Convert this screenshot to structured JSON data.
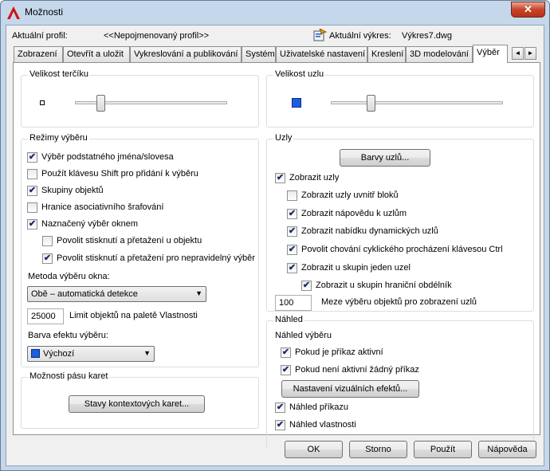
{
  "window": {
    "title": "Možnosti",
    "close_glyph": "✕"
  },
  "header": {
    "profile_label": "Aktuální profil:",
    "profile_value": "<<Nepojmenovaný profil>>",
    "drawing_label": "Aktuální výkres:",
    "drawing_value": "Výkres7.dwg"
  },
  "tabs": [
    {
      "label": "Zobrazení"
    },
    {
      "label": "Otevřít a uložit"
    },
    {
      "label": "Vykreslování a publikování"
    },
    {
      "label": "Systém"
    },
    {
      "label": "Uživatelské nastavení"
    },
    {
      "label": "Kreslení"
    },
    {
      "label": "3D modelování"
    },
    {
      "label": "Výběr"
    }
  ],
  "tab_scroll": {
    "left": "◄",
    "right": "►"
  },
  "pickbox": {
    "title": "Velikost terčíku",
    "level": 0.15
  },
  "grip_size": {
    "title": "Velikost uzlu",
    "level": 0.22
  },
  "selection_modes": {
    "title": "Režimy výběru",
    "items": [
      {
        "label": "Výběr podstatného jména/slovesa",
        "checked": true
      },
      {
        "label": "Použít klávesu Shift pro přidání k výběru",
        "checked": false
      },
      {
        "label": "Skupiny objektů",
        "checked": true
      },
      {
        "label": "Hranice asociativního šrafování",
        "checked": false
      },
      {
        "label": "Naznačený výběr oknem",
        "checked": true
      },
      {
        "label": "Povolit stisknutí a přetažení u objektu",
        "checked": false
      },
      {
        "label": "Povolit stisknutí a přetažení pro nepravidelný výběr",
        "checked": true
      }
    ],
    "window_method_label": "Metoda výběru okna:",
    "window_method_value": "Obě – automatická detekce",
    "object_limit_value": "25000",
    "object_limit_label": "Limit objektů na paletě Vlastnosti",
    "effect_color_label": "Barva efektu výběru:",
    "effect_color_value": "Výchozí",
    "effect_color_hex": "#1b5ee0"
  },
  "ribbon": {
    "title": "Možnosti pásu karet",
    "button_label": "Stavy kontextových karet..."
  },
  "grips": {
    "title": "Uzly",
    "colors_button": "Barvy uzlů...",
    "items": [
      {
        "label": "Zobrazit uzly",
        "checked": true
      },
      {
        "label": "Zobrazit uzly uvnitř bloků",
        "checked": false
      },
      {
        "label": "Zobrazit nápovědu k uzlům",
        "checked": true
      },
      {
        "label": "Zobrazit nabídku dynamických uzlů",
        "checked": true
      },
      {
        "label": "Povolit chování cyklického procházení klávesou Ctrl",
        "checked": true
      },
      {
        "label": "Zobrazit u skupin jeden uzel",
        "checked": true
      },
      {
        "label": "Zobrazit u skupin hraniční obdélník",
        "checked": true
      }
    ],
    "limit_value": "100",
    "limit_label": "Meze výběru objektů pro zobrazení uzlů"
  },
  "preview": {
    "title": "Náhled",
    "subtitle": "Náhled výběru",
    "items": [
      {
        "label": "Pokud je příkaz aktivní",
        "checked": true
      },
      {
        "label": "Pokud není aktivní žádný příkaz",
        "checked": true
      }
    ],
    "effects_button": "Nastavení vizuálních efektů...",
    "items2": [
      {
        "label": "Náhled příkazu",
        "checked": true
      },
      {
        "label": "Náhled vlastnosti",
        "checked": true
      }
    ]
  },
  "footer": {
    "ok": "OK",
    "cancel": "Storno",
    "apply": "Použít",
    "help": "Nápověda"
  },
  "icons": {
    "checkmark": "✔",
    "dropdown": "▼"
  }
}
